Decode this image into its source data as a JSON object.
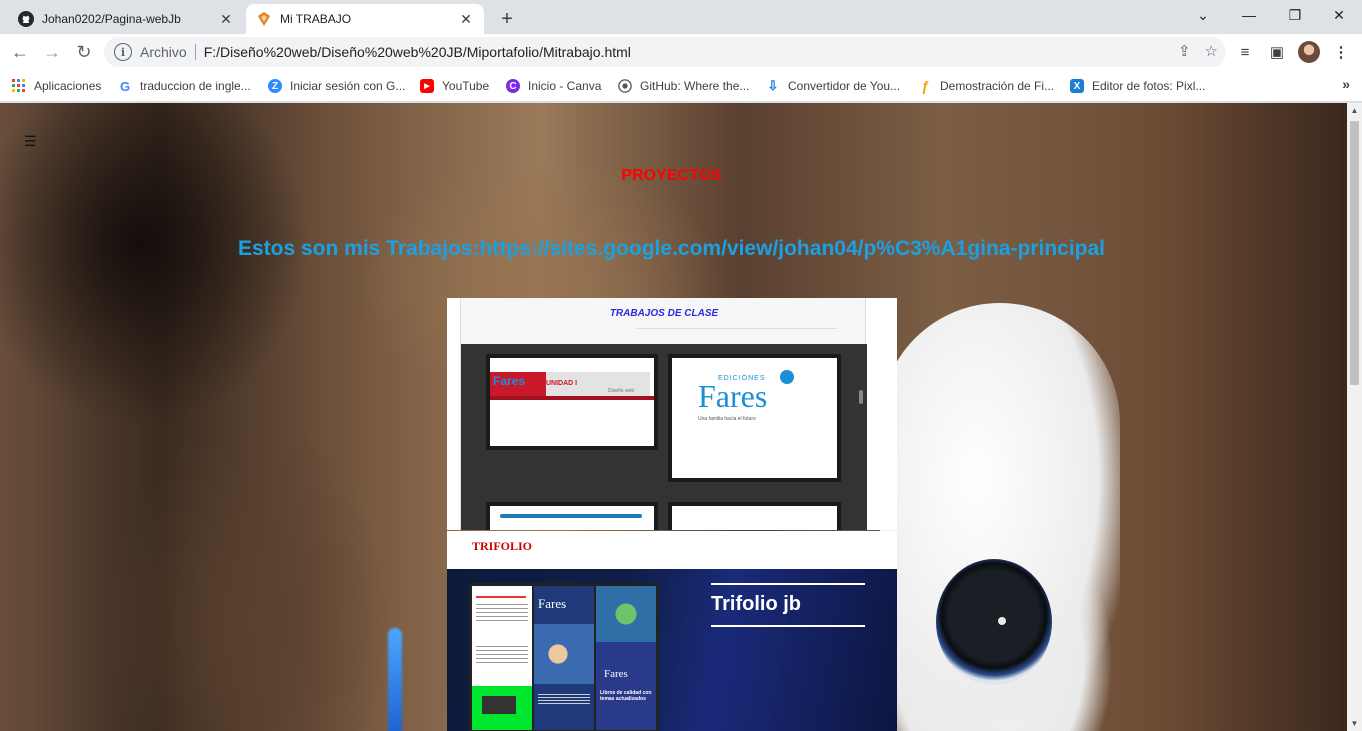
{
  "browser": {
    "tabs": [
      {
        "title": "Johan0202/Pagina-webJb",
        "icon": "github-icon",
        "active": false
      },
      {
        "title": "Mi TRABAJO",
        "icon": "html-file-icon",
        "active": true
      }
    ],
    "close_glyph": "✕",
    "new_tab_glyph": "+",
    "window_controls": {
      "tab_search": "⌄",
      "minimize": "—",
      "restore": "❐",
      "close": "✕"
    }
  },
  "toolbar": {
    "back": "←",
    "forward": "→",
    "reload": "↻",
    "info_glyph": "i",
    "scheme_label": "Archivo",
    "url": "F:/Diseño%20web/Diseño%20web%20JB/Miportafolio/Mitrabajo.html",
    "share": "⇪",
    "star": "☆",
    "media": "≡",
    "sidepanel": "▣",
    "menu": "⋮"
  },
  "bookmarks": {
    "items": [
      {
        "label": "Aplicaciones",
        "icon": "apps-grid-icon"
      },
      {
        "label": "traduccion de ingle...",
        "icon": "google-icon"
      },
      {
        "label": "Iniciar sesión con G...",
        "icon": "zoom-icon"
      },
      {
        "label": "YouTube",
        "icon": "youtube-icon"
      },
      {
        "label": "Inicio - Canva",
        "icon": "canva-icon"
      },
      {
        "label": "GitHub: Where the...",
        "icon": "github-icon"
      },
      {
        "label": "Convertidor de You...",
        "icon": "download-cloud-icon"
      },
      {
        "label": "Demostración de Fi...",
        "icon": "fidelity-icon"
      },
      {
        "label": "Editor de fotos: Pixl...",
        "icon": "pixlr-icon"
      }
    ],
    "more": "»"
  },
  "page": {
    "menu_glyph": "☰",
    "proyectos": "PROYECTOS",
    "trabajos": "Estos son mis Trabajos:https://sites.google.com/view/johan04/p%C3%A1gina-principal",
    "frame1": {
      "title": "TRABAJOS DE CLASE",
      "thumb_unidad": "UNIDAD I",
      "thumb_unidad_sub": "Diseño web",
      "brand_small": "EDICIONES",
      "brand": "Fares",
      "brand_tagline": "Una familia hacia el futuro"
    },
    "frame2": {
      "title": "TRIFOLIO",
      "heading": "Trifolio jb",
      "panel_text": "Libros de calidad con temas actualizados"
    }
  },
  "scrollbar": {
    "up": "▲",
    "down": "▼"
  },
  "colors": {
    "proyectos": "#ff0000",
    "trabajos": "#1ba1e2",
    "frame1_title": "#2a2ae0",
    "fares_blue": "#1a8fd8"
  }
}
